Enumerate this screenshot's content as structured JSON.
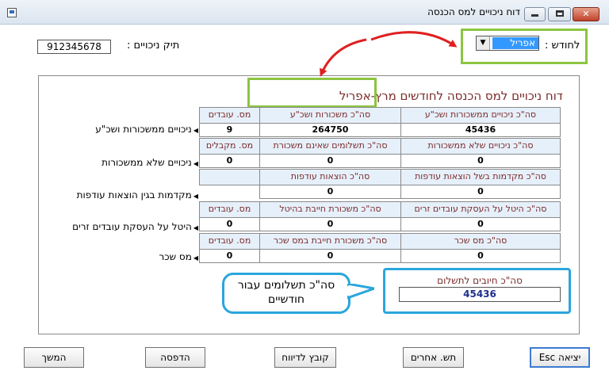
{
  "window": {
    "title": "דוח ניכויים למס הכנסה"
  },
  "file_number": {
    "label": "תיק ניכויים :",
    "value": "912345678"
  },
  "month": {
    "label": "לחודש :",
    "value": "אפריל"
  },
  "report": {
    "title": "דוח ניכויים למס הכנסה לחודשים מרץ-אפריל",
    "sections": {
      "s1": {
        "row_label": "ניכויים ממשכורות ושכ\"ע",
        "h1": "סה\"כ ניכויים ממשכורות ושכ\"ע",
        "h2": "סה\"כ משכורות ושכ\"ע",
        "h3": "מס. עובדים",
        "v1": "45436",
        "v2": "264750",
        "v3": "9"
      },
      "s2": {
        "row_label": "ניכויים שלא ממשכורות",
        "h1": "סה\"כ ניכויים שלא ממשכורות",
        "h2": "סה\"כ תשלומים שאינם משכורת",
        "h3": "מס. מקבלים",
        "v1": "0",
        "v2": "0",
        "v3": "0"
      },
      "s3": {
        "row_label": "מקדמות בגין הוצאות עודפות",
        "h1": "סה\"כ מקדמות בשל הוצאות עודפות",
        "h2": "סה\"כ הוצאות עודפות",
        "v1": "0",
        "v2": "0"
      },
      "s4": {
        "row_label": "היטל על העסקת עובדים זרים",
        "h1": "סה\"כ היטל על העסקת עובדים זרים",
        "h2": "סה\"כ משכורת חייבת בהיטל",
        "h3": "מס. עובדים",
        "v1": "0",
        "v2": "0",
        "v3": "0"
      },
      "s5": {
        "row_label": "מס שכר",
        "h1": "סה\"כ מס שכר",
        "h2": "סה\"כ משכורת חייבת במס שכר",
        "h3": "מס. עובדים",
        "v1": "0",
        "v2": "0",
        "v3": "0"
      }
    },
    "total": {
      "label": "סה\"כ חיובים לתשלום",
      "value": "45436"
    }
  },
  "callout": {
    "line1": "סה\"כ תשלומים עבור",
    "line2": "חודשיים"
  },
  "buttons": {
    "exit": "יציאה Esc",
    "others": "תש. אחרים",
    "report_file": "קובץ לדיווח",
    "print": "הדפסה",
    "continue": "המשך"
  },
  "colors": {
    "highlight_green": "#8cc540",
    "highlight_blue": "#2aa6dc",
    "arrow_red": "#e02020",
    "header_text": "#7b2b2b"
  }
}
